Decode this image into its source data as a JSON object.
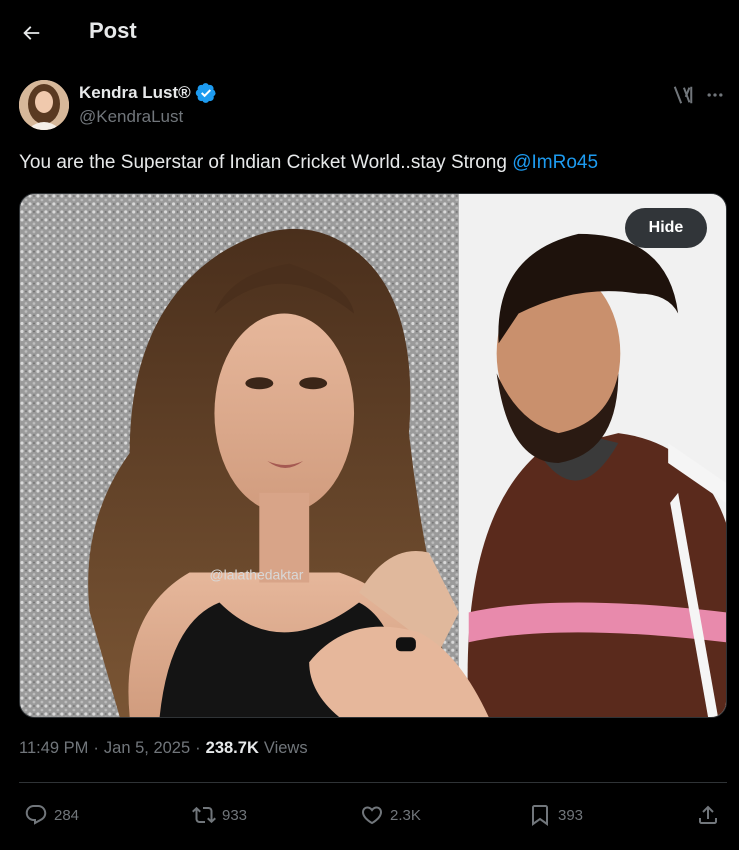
{
  "header": {
    "title": "Post"
  },
  "author": {
    "display_name": "Kendra Lust®",
    "handle": "@KendraLust",
    "verified": true,
    "verified_color": "#1d9bf0"
  },
  "tweet": {
    "text": "You are the Superstar of Indian Cricket World..stay Strong ",
    "mention": "@ImRo45"
  },
  "media": {
    "watermark": "@lalathedaktar",
    "hide_label": "Hide"
  },
  "meta": {
    "time": "11:49 PM",
    "separator1": "·",
    "date": "Jan 5, 2025",
    "separator2": "·",
    "views_count": "238.7K",
    "views_label": "Views"
  },
  "actions": {
    "replies": "284",
    "reposts": "933",
    "likes": "2.3K",
    "bookmarks": "393"
  },
  "icons": {
    "back": "back-arrow-icon",
    "verified": "verified-badge-icon",
    "grok": "grok-icon",
    "more": "more-dots-icon",
    "reply": "reply-icon",
    "repost": "repost-icon",
    "like": "heart-icon",
    "bookmark": "bookmark-icon",
    "share": "share-icon"
  },
  "colors": {
    "background": "#000000",
    "text_primary": "#e7e9ea",
    "text_secondary": "#71767b",
    "accent": "#1d9bf0",
    "border": "#2f3336"
  }
}
